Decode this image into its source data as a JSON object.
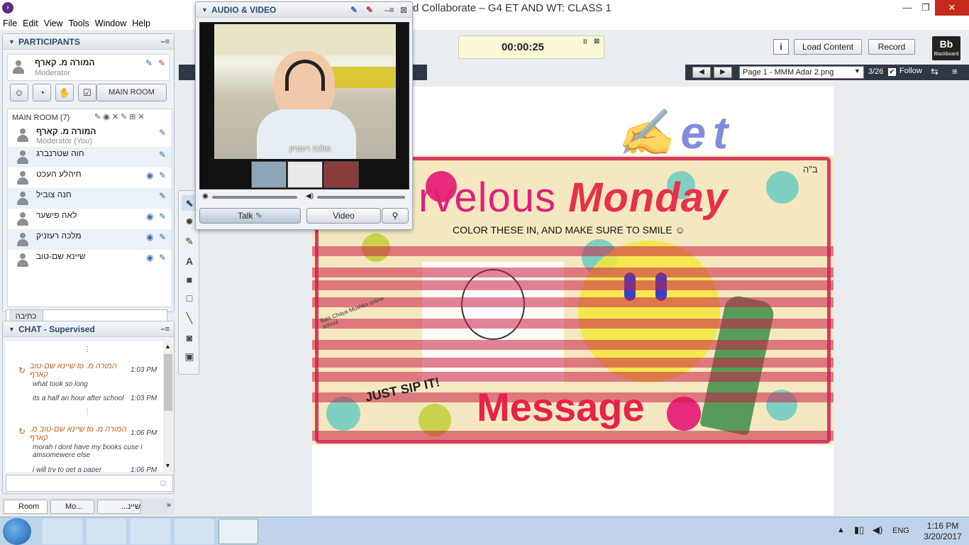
{
  "window": {
    "title": "d Collaborate – G4 ET AND WT: CLASS 1",
    "minimize": "—",
    "maximize": "❐",
    "close": "✕"
  },
  "menu": [
    "File",
    "Edit",
    "View",
    "Tools",
    "Window",
    "Help"
  ],
  "participants": {
    "title": "PARTICIPANTS",
    "moderator": {
      "name": "המורה מ. קארף",
      "role": "Moderator"
    },
    "main_room_button": "MAIN ROOM",
    "room_label": "MAIN ROOM",
    "room_count": "(7)",
    "rows": [
      {
        "name": "המורה מ. קארף",
        "sub": "Moderator (You)",
        "icons": "✎"
      },
      {
        "name": "חוה שטרנברג",
        "sub": "",
        "icons": "✎"
      },
      {
        "name": "חיהלע העכט",
        "sub": "",
        "icons": "◉ ✎"
      },
      {
        "name": "חנה צוביל",
        "sub": "",
        "icons": "✎"
      },
      {
        "name": "לאה פישער",
        "sub": "",
        "icons": "◉ ✎"
      },
      {
        "name": "מלכה רעזניק",
        "sub": "",
        "icons": "◉ ✎"
      },
      {
        "name": "שיינא שם-טוב",
        "sub": "",
        "icons": "◉ ✎"
      }
    ],
    "input_label": "כתיבה"
  },
  "chat": {
    "title": "CHAT - Supervised",
    "messages": [
      {
        "from": "המורה מ. to שיינא שם-טוב קארף",
        "time": "1:03 PM",
        "body": "what took so long"
      },
      {
        "from": "",
        "time": "1:03 PM",
        "body": "its a half an hour after school"
      },
      {
        "from": "המורה מ. to שיינא שם-טוב מ. קארף",
        "time": "1:06 PM",
        "body": "morah i dont have my books cuse i amsomewere else"
      },
      {
        "from": "",
        "time": "1:06 PM",
        "body": "i will try to get a paper"
      }
    ],
    "tabs": [
      "Room",
      "Mo...",
      "שיינ..."
    ]
  },
  "audio_video": {
    "title": "AUDIO & VIDEO",
    "caption": "מלכה רעזניק",
    "talk": "Talk",
    "video": "Video"
  },
  "toolbar": {
    "timer": "00:00:25",
    "info": "i",
    "load_content": "Load Content",
    "record": "Record",
    "logo": "Bb",
    "logo_sub": "Blackboard"
  },
  "navigation": {
    "page": "Page 1 - MMM Adar 2.png",
    "count": "3/26",
    "follow": "Follow"
  },
  "slide": {
    "title_a": "rvelous",
    "title_b": "Monday",
    "subtitle": "COLOR  THESE  IN, AND MAKE SURE TO SMILE ☺",
    "corner": "ב\"ה",
    "message": "Message",
    "school": "Bais Chaya Mushka online school",
    "sticker": "JUST SIP IT!"
  },
  "taskbar": {
    "lang": "ENG",
    "time": "1:16 PM",
    "date": "3/20/2017"
  },
  "colors": {
    "accent": "#2e4a6b",
    "slide_bg": "#f5e8c0",
    "title_pink": "#e0207a",
    "message_red": "#e8204a",
    "timer_bg": "#fbf8d8"
  }
}
